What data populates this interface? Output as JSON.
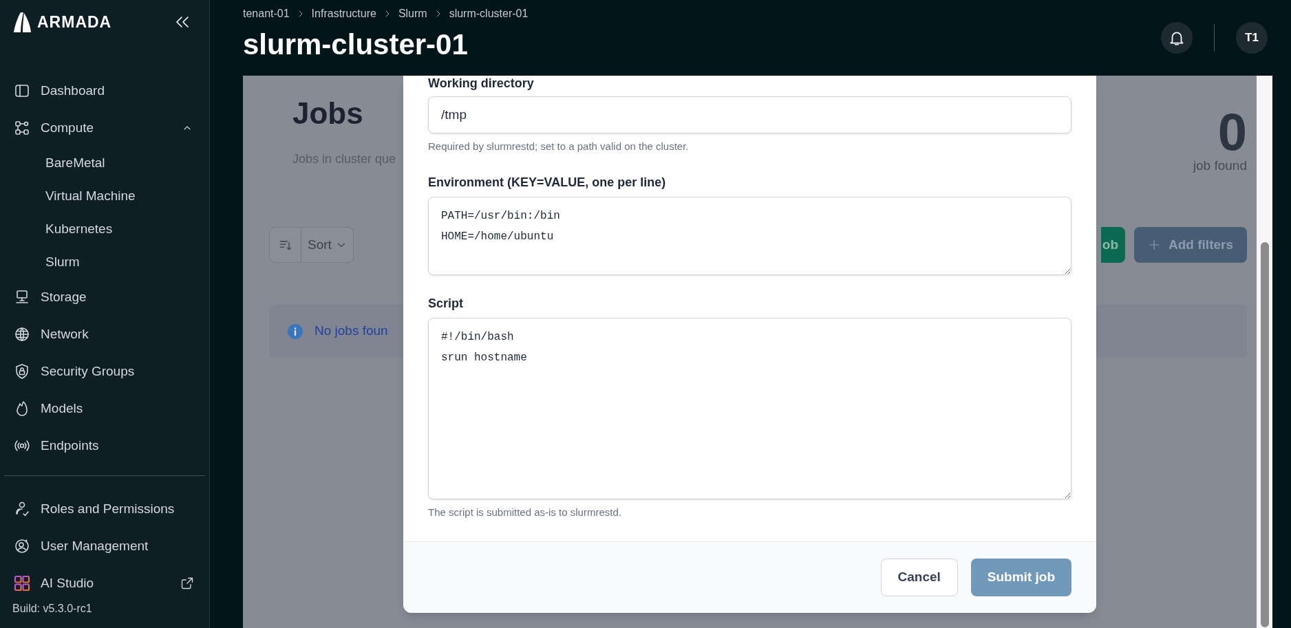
{
  "sidebar": {
    "brand": "ARMADA",
    "items": [
      {
        "label": "Dashboard"
      },
      {
        "label": "Compute",
        "expanded": true,
        "children": [
          {
            "label": "BareMetal"
          },
          {
            "label": "Virtual Machine"
          },
          {
            "label": "Kubernetes"
          },
          {
            "label": "Slurm"
          }
        ]
      },
      {
        "label": "Storage"
      },
      {
        "label": "Network"
      },
      {
        "label": "Security Groups"
      },
      {
        "label": "Models"
      },
      {
        "label": "Endpoints"
      }
    ],
    "bottom_items": [
      {
        "label": "Roles and Permissions",
        "external": false
      },
      {
        "label": "User Management",
        "external": false
      },
      {
        "label": "AI Studio",
        "external": true
      }
    ],
    "build": "Build: v5.3.0-rc1"
  },
  "header": {
    "breadcrumbs": [
      "tenant-01",
      "Infrastructure",
      "Slurm",
      "slurm-cluster-01"
    ],
    "title": "slurm-cluster-01",
    "avatar": "T1"
  },
  "page": {
    "title": "Jobs",
    "subtitle": "Jobs in cluster que",
    "count": "0",
    "count_label": "job found",
    "sort_label": "Sort",
    "primary_button": "ob",
    "filter_button": "Add filters",
    "alert": "No jobs foun"
  },
  "modal": {
    "fields": [
      {
        "kind": "input",
        "label": "Working directory",
        "value": "/tmp",
        "hint": "Required by slurmrestd; set to a path valid on the cluster."
      },
      {
        "kind": "textarea",
        "label": "Environment (KEY=VALUE, one per line)",
        "value": "PATH=/usr/bin:/bin\nHOME=/home/ubuntu"
      },
      {
        "kind": "textarea",
        "label": "Script",
        "value": "#!/bin/bash\nsrun hostname",
        "hint": "The script is submitted as-is to slurmrestd."
      }
    ],
    "buttons": [
      {
        "label": "Cancel",
        "kind": "secondary",
        "disabled": false
      },
      {
        "label": "Submit job",
        "kind": "primary",
        "disabled": true
      }
    ]
  }
}
